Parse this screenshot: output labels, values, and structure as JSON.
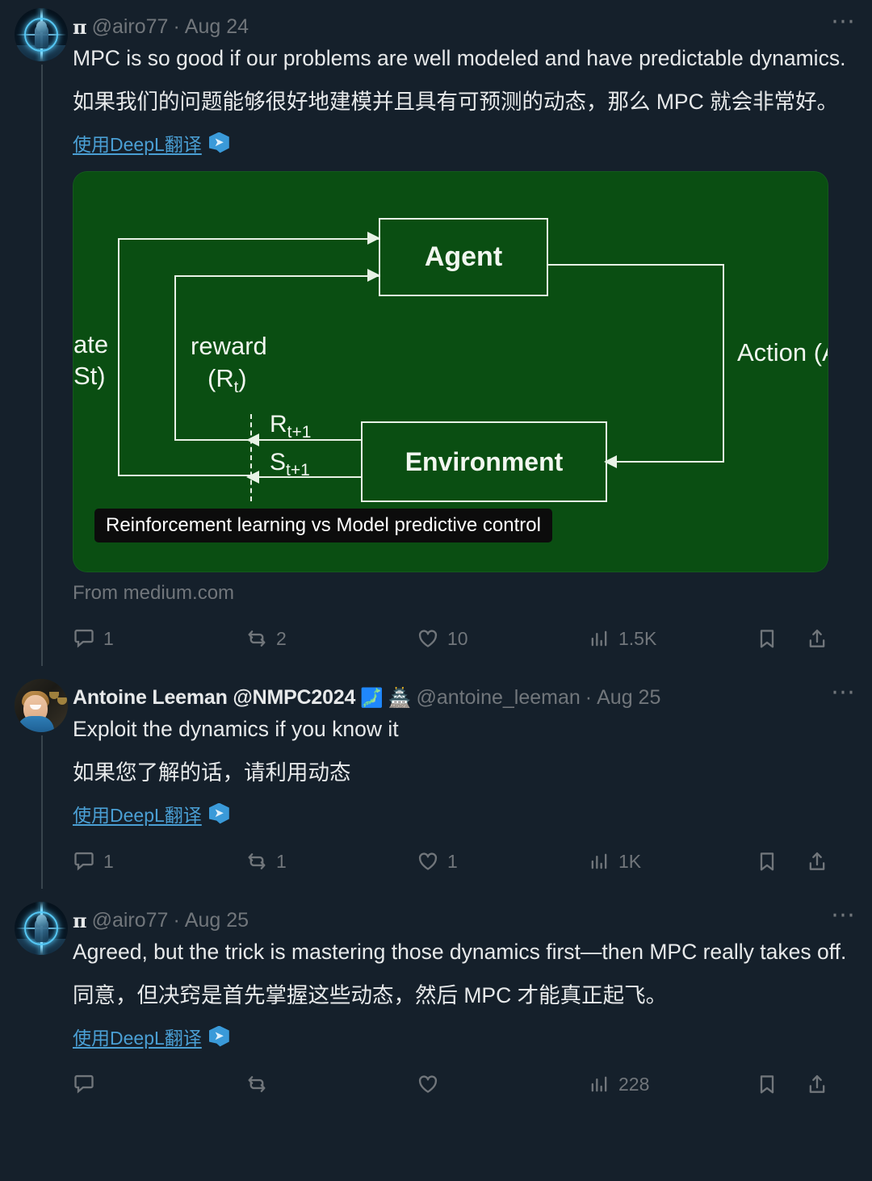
{
  "theme": {
    "background": "#15202b",
    "text_primary": "#e7e9ea",
    "text_muted": "#71767b",
    "link_blue": "#4a9fd4",
    "diagram_green": "#0a4e12",
    "thread_line": "#38444d"
  },
  "tweets": [
    {
      "id": "tweet-1",
      "author": {
        "glyph": "π",
        "handle": "@airo77",
        "separator": "·",
        "date": "Aug 24",
        "avatar_icon": "pi-sci-fi-avatar"
      },
      "text_en": "MPC is so good if our problems are well modeled and have predictable dynamics.",
      "text_cn": "如果我们的问题能够很好地建模并且具有可预测的动态，那么 MPC 就会非常好。",
      "deepl_label": "使用DeepL翻译",
      "deepl_icon": "deepl-icon",
      "media": {
        "source_label": "From medium.com",
        "caption": "Reinforcement learning vs Model predictive control",
        "diagram": {
          "agent_box": "Agent",
          "environment_box": "Environment",
          "label_state": "ate",
          "label_state_sub": "St)",
          "label_reward": "reward",
          "label_reward_sub": "(R",
          "label_reward_sub_t": "t",
          "label_reward_close": ")",
          "label_rt1": "R",
          "label_rt1_sub": "t+1",
          "label_st1": "S",
          "label_st1_sub": "t+1",
          "label_action": "Action (A"
        }
      },
      "actions": {
        "reply": "1",
        "retweet": "2",
        "like": "10",
        "views": "1.5K",
        "bookmark_icon": "bookmark-icon",
        "share_icon": "share-icon"
      },
      "more_icon": "more-options-icon"
    },
    {
      "id": "tweet-2",
      "author": {
        "display_name": "Antoine Leeman @NMPC2024",
        "emoji_1": "🗾",
        "emoji_2": "🏯",
        "handle": "@antoine_leeman",
        "separator": "·",
        "date": "Aug 25",
        "avatar_icon": "photo-portrait-avatar"
      },
      "text_en": "Exploit the dynamics if you know it",
      "text_cn": "如果您了解的话，请利用动态",
      "deepl_label": "使用DeepL翻译",
      "deepl_icon": "deepl-icon",
      "actions": {
        "reply": "1",
        "retweet": "1",
        "like": "1",
        "views": "1K",
        "bookmark_icon": "bookmark-icon",
        "share_icon": "share-icon"
      },
      "more_icon": "more-options-icon"
    },
    {
      "id": "tweet-3",
      "author": {
        "glyph": "π",
        "handle": "@airo77",
        "separator": "·",
        "date": "Aug 25",
        "avatar_icon": "pi-sci-fi-avatar"
      },
      "text_en": "Agreed, but the trick is mastering those dynamics first—then MPC really takes off.",
      "text_cn": "同意，但决窍是首先掌握这些动态，然后 MPC 才能真正起飞。",
      "deepl_label": "使用DeepL翻译",
      "deepl_icon": "deepl-icon",
      "actions": {
        "reply": "",
        "retweet": "",
        "like": "",
        "views": "228",
        "bookmark_icon": "bookmark-icon",
        "share_icon": "share-icon"
      },
      "more_icon": "more-options-icon"
    }
  ]
}
